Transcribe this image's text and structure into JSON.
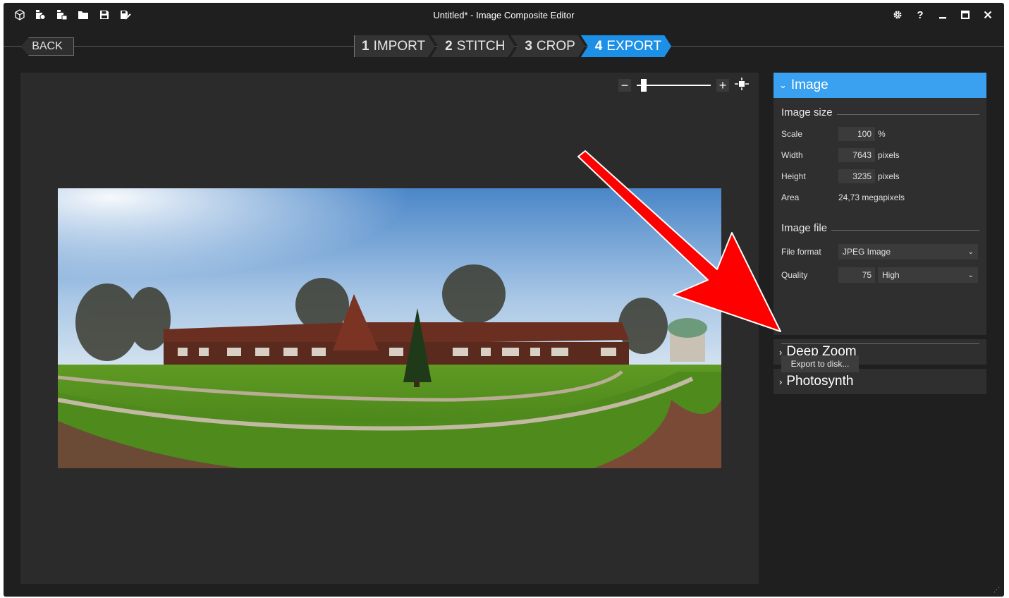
{
  "window": {
    "title": "Untitled* - Image Composite Editor",
    "toolbar_icons": [
      "cube-icon",
      "new-panorama-from-images-icon",
      "new-panorama-from-video-icon",
      "open-folder-icon",
      "save-icon",
      "save-as-icon"
    ],
    "controls": [
      "settings-gear-icon",
      "help-icon",
      "minimize-icon",
      "maximize-icon",
      "close-icon"
    ]
  },
  "wizard": {
    "back_label": "BACK",
    "steps": [
      {
        "num": "1",
        "label": "IMPORT",
        "active": false
      },
      {
        "num": "2",
        "label": "STITCH",
        "active": false
      },
      {
        "num": "3",
        "label": "CROP",
        "active": false
      },
      {
        "num": "4",
        "label": "EXPORT",
        "active": true
      }
    ]
  },
  "zoom": {
    "minus": "−",
    "plus": "+",
    "level": 0.05
  },
  "panel": {
    "image_section": {
      "title": "Image",
      "image_size": {
        "heading": "Image size",
        "scale_label": "Scale",
        "scale_value": "100",
        "scale_unit": "%",
        "width_label": "Width",
        "width_value": "7643",
        "width_unit": "pixels",
        "height_label": "Height",
        "height_value": "3235",
        "height_unit": "pixels",
        "area_label": "Area",
        "area_value": "24,73 megapixels"
      },
      "image_file": {
        "heading": "Image file",
        "format_label": "File format",
        "format_value": "JPEG Image",
        "quality_label": "Quality",
        "quality_value": "75",
        "quality_level": "High"
      },
      "export_button": "Export to disk..."
    },
    "deep_zoom_title": "Deep Zoom",
    "photosynth_title": "Photosynth"
  },
  "colors": {
    "accent": "#1c8fe6",
    "panel": "#2f2f2f",
    "annotation_arrow": "#ff0000"
  }
}
